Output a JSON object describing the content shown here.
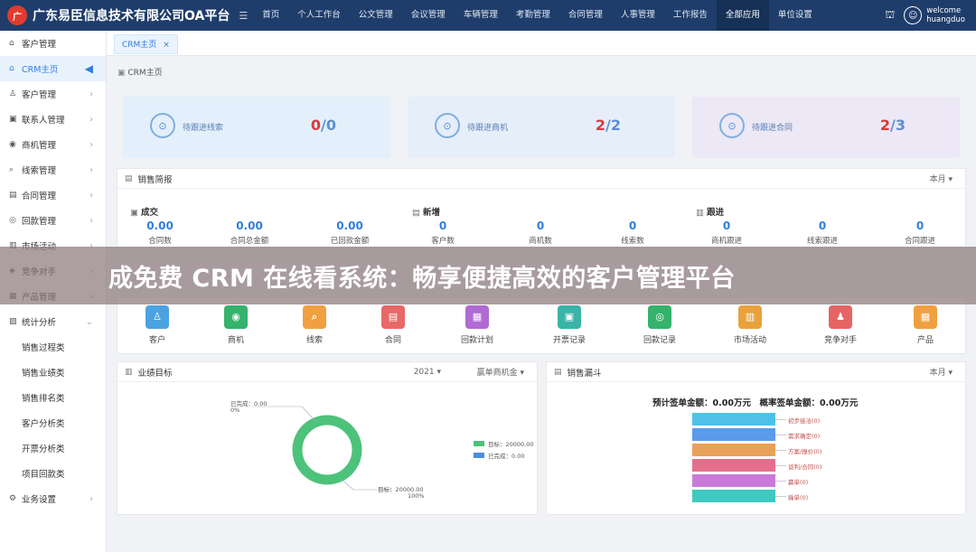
{
  "header": {
    "logo_glyph": "广",
    "brand": "广东易臣信息技术有限公司OA平台",
    "menu_icon": "☰",
    "nav": [
      "首页",
      "个人工作台",
      "公文管理",
      "会议管理",
      "车辆管理",
      "考勤管理",
      "合同管理",
      "人事管理",
      "工作报告",
      "全部应用",
      "单位设置"
    ],
    "active_nav": "全部应用",
    "welcome": "welcome",
    "user": "huangduo"
  },
  "sidebar": [
    {
      "label": "客户管理",
      "icon": "home-icon",
      "glyph": "⌂"
    },
    {
      "label": "CRM主页",
      "icon": "home-icon",
      "glyph": "⌂",
      "active": true
    },
    {
      "label": "客户管理",
      "icon": "people-icon",
      "glyph": "♙"
    },
    {
      "label": "联系人管理",
      "icon": "contact-icon",
      "glyph": "▣"
    },
    {
      "label": "商机管理",
      "icon": "opportunity-icon",
      "glyph": "◉"
    },
    {
      "label": "线索管理",
      "icon": "search-icon",
      "glyph": "⌕"
    },
    {
      "label": "合同管理",
      "icon": "contract-icon",
      "glyph": "▤"
    },
    {
      "label": "回款管理",
      "icon": "payment-icon",
      "glyph": "◎"
    },
    {
      "label": "市场活动",
      "icon": "market-icon",
      "glyph": "▥"
    },
    {
      "label": "竞争对手",
      "icon": "competitor-icon",
      "glyph": "◈"
    },
    {
      "label": "产品管理",
      "icon": "product-icon",
      "glyph": "▦"
    },
    {
      "label": "统计分析",
      "icon": "chart-icon",
      "glyph": "▨",
      "expanded": true
    },
    {
      "label": "销售过程类",
      "sub": true
    },
    {
      "label": "销售业绩类",
      "sub": true
    },
    {
      "label": "销售排名类",
      "sub": true
    },
    {
      "label": "客户分析类",
      "sub": true
    },
    {
      "label": "开票分析类",
      "sub": true
    },
    {
      "label": "项目回款类",
      "sub": true
    },
    {
      "label": "业务设置",
      "icon": "settings-icon",
      "glyph": "⚙"
    }
  ],
  "tab": {
    "label": "CRM主页",
    "close": "×"
  },
  "breadcrumb": "CRM主页",
  "stats": [
    {
      "label": "待跟进线索",
      "a": "0",
      "b": "/0",
      "bg": "#e3f0fb",
      "icon": "clue-icon"
    },
    {
      "label": "待跟进商机",
      "a": "2",
      "b": "/2",
      "bg": "#e6eefa",
      "icon": "money-icon"
    },
    {
      "label": "待跟进合同",
      "a": "2",
      "b": "/3",
      "bg": "#ece8f6",
      "icon": "contract-icon"
    }
  ],
  "brief": {
    "title": "销售简报",
    "period": "本月 ▾",
    "groups": [
      {
        "name": "成交",
        "items": [
          {
            "v": "0.00",
            "k": "合同数"
          },
          {
            "v": "0.00",
            "k": "合同总金额"
          },
          {
            "v": "0.00",
            "k": "已回款金额"
          }
        ]
      },
      {
        "name": "新增",
        "items": [
          {
            "v": "0",
            "k": "客户数"
          },
          {
            "v": "0",
            "k": "商机数"
          },
          {
            "v": "0",
            "k": "线索数"
          }
        ]
      },
      {
        "name": "跟进",
        "items": [
          {
            "v": "0",
            "k": "商机跟进"
          },
          {
            "v": "0",
            "k": "线索跟进"
          },
          {
            "v": "0",
            "k": "合同跟进"
          }
        ]
      }
    ]
  },
  "banner": "成免费 CRM 在线看系统：畅享便捷高效的客户管理平台",
  "quick": [
    {
      "label": "客户",
      "color": "#4aa3e0",
      "glyph": "♙"
    },
    {
      "label": "商机",
      "color": "#35b26c",
      "glyph": "◉"
    },
    {
      "label": "线索",
      "color": "#f0a040",
      "glyph": "⌕"
    },
    {
      "label": "合同",
      "color": "#e86868",
      "glyph": "▤"
    },
    {
      "label": "回款计划",
      "color": "#b06ad4",
      "glyph": "▦"
    },
    {
      "label": "开票记录",
      "color": "#3bb3a8",
      "glyph": "▣"
    },
    {
      "label": "回款记录",
      "color": "#35b26c",
      "glyph": "◎"
    },
    {
      "label": "市场活动",
      "color": "#e9a23b",
      "glyph": "▥"
    },
    {
      "label": "竞争对手",
      "color": "#e56565",
      "glyph": "♟"
    },
    {
      "label": "产品",
      "color": "#f0a040",
      "glyph": "▦"
    }
  ],
  "target": {
    "title": "业绩目标",
    "year": "2021 ▾",
    "type": "赢单商机金 ▾",
    "label_top1": "已完成：0.00",
    "label_top2": "0%",
    "label_bot1": "目标：20000.00",
    "label_bot2": "100%",
    "legend": [
      {
        "name": "目标：20000.00",
        "color": "#4cc27a"
      },
      {
        "name": "已完成：0.00",
        "color": "#4a90e2"
      }
    ]
  },
  "funnel": {
    "title": "销售漏斗",
    "period": "本月 ▾",
    "summary": "预计签单金额：0.00万元　概率签单金额：0.00万元",
    "stages": [
      {
        "label": "初步接洽(0)",
        "color": "#4fc1e9"
      },
      {
        "label": "需求确定(0)",
        "color": "#5a9bea"
      },
      {
        "label": "方案/报价(0)",
        "color": "#e8a15a"
      },
      {
        "label": "谈判/合同(0)",
        "color": "#e46f8d"
      },
      {
        "label": "赢单(0)",
        "color": "#c97ad8"
      },
      {
        "label": "输单(0)",
        "color": "#40c9c0"
      }
    ]
  }
}
